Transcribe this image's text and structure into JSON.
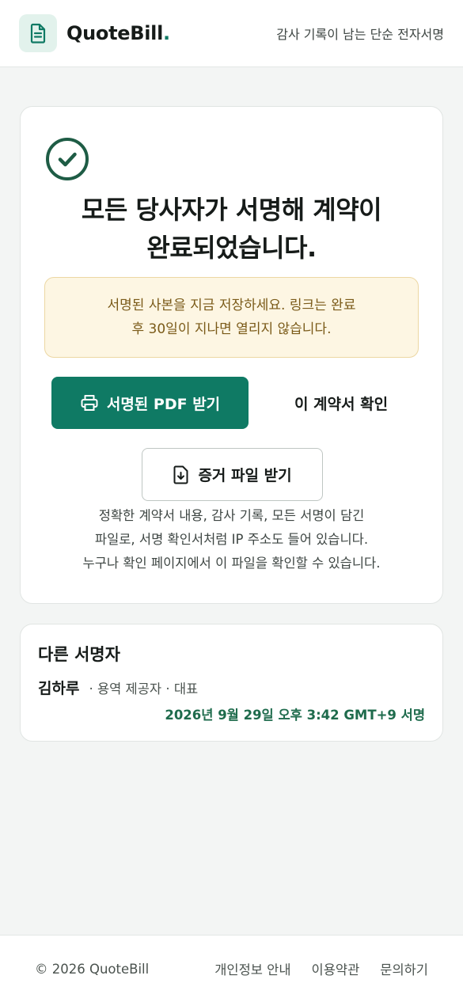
{
  "header": {
    "brand_name": "QuoteBill",
    "brand_dot": ".",
    "tagline": "감사 기록이 남는 단순 전자서명",
    "logo_icon": "document-icon"
  },
  "completion": {
    "status_icon": "check-circle-icon",
    "headline_line1": "모든 당사자가 서명해 계약이",
    "headline_line2": "완료되었습니다.",
    "notice_line1": "서명된 사본을 지금 저장하세요. 링크는 완료",
    "notice_line2": "후 30일이 지나면 열리지 않습니다.",
    "download_pdf_label": "서명된 PDF 받기",
    "view_contract_label": "이 계약서 확인",
    "evidence_label": "증거 파일 받기",
    "evidence_desc_line1": "정확한 계약서 내용, 감사 기록, 모든 서명이 담긴",
    "evidence_desc_line2": "파일로, 서명 확인서처럼 IP 주소도 들어 있습니다.",
    "evidence_desc_line3": "누구나 확인 페이지에서 이 파일을 확인할 수 있습니다."
  },
  "signers": {
    "title": "다른 서명자",
    "items": [
      {
        "name": "김하루",
        "role": "· 용역 제공자 · 대표",
        "signed_at": "2026년 9월 29일 오후 3:42 GMT+9 서명"
      }
    ]
  },
  "footer": {
    "copyright": "© 2026 QuoteBill",
    "links": [
      "개인정보 안내",
      "이용약관",
      "문의하기"
    ]
  },
  "colors": {
    "accent": "#0f7a64",
    "notice_bg": "#fdf6e3",
    "notice_text": "#7a5a18",
    "signed_text": "#1e6b4c"
  }
}
